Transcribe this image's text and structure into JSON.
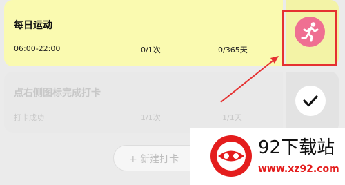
{
  "tasks": [
    {
      "title": "每日运动",
      "time": "06:00-22:00",
      "today": "0/1次",
      "total": "0/365天",
      "action_icon": "running-person-icon"
    },
    {
      "title": "点右侧图标完成打卡",
      "status": "打卡成功",
      "today": "1/1次",
      "total": "1/1天",
      "action_icon": "checkmark-icon"
    }
  ],
  "new_button": {
    "label": "+ 新建打卡"
  },
  "watermark": {
    "title": "92下载站",
    "url": "www.xz92.com"
  },
  "colors": {
    "active_card": "#fafab0",
    "sport_icon_bg": "#ef6f92",
    "annotation_red": "#e53131"
  }
}
